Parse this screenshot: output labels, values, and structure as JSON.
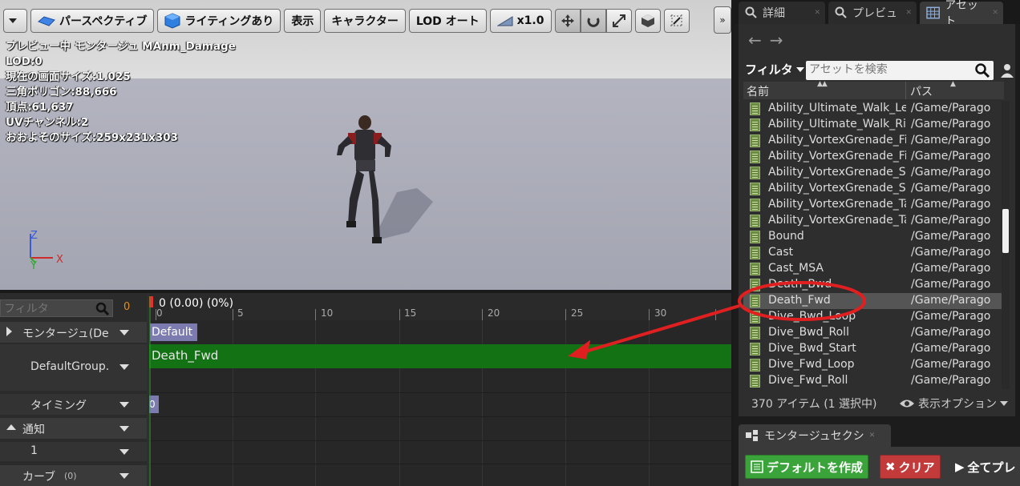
{
  "viewport": {
    "toolbar": {
      "perspective_label": "パースペクティブ",
      "lighting_label": "ライティングあり",
      "show_label": "表示",
      "character_label": "キャラクター",
      "lod_label": "LOD オート",
      "speed_label": "x1.0",
      "more_label": "»"
    },
    "stats": [
      "プレビュー中 モンタージュ MAnm_Damage",
      "LOD:0",
      "現在の画面サイズ:1.025",
      "三角ポリゴン:88,666",
      "頂点:61,637",
      "UVチャンネル:2",
      "おおよそのサイズ:259x231x303"
    ],
    "axis": {
      "z": "Z",
      "x": "X",
      "y": "Y"
    }
  },
  "timeline": {
    "filter_placeholder": "フィルタ",
    "count": "0",
    "position_readout": "0 (0.00) (0%)",
    "ruler_labels": [
      "0",
      "5",
      "10",
      "15",
      "20",
      "25",
      "30"
    ],
    "rows": {
      "montage": "モンタージュ(De",
      "default_group": "DefaultGroup.",
      "timing": "タイミング",
      "notify": "通知",
      "notify_track": "1",
      "curve": "カーブ",
      "curve_count": "(0)"
    },
    "segments": {
      "default_section": "Default",
      "slot_anim": "Death_Fwd",
      "timing_marker": "0"
    }
  },
  "right_panel": {
    "tabs": [
      {
        "label": "詳細",
        "icon": "details-icon"
      },
      {
        "label": "プレビュ",
        "icon": "preview-icon"
      },
      {
        "label": "アセット",
        "icon": "grid-icon"
      }
    ],
    "filter_label": "フィルタ",
    "search_placeholder": "アセットを検索",
    "columns": {
      "name": "名前",
      "path": "パス"
    },
    "assets": [
      {
        "name": "Ability_Ultimate_Walk_Left",
        "path": "/Game/Paragon"
      },
      {
        "name": "Ability_Ultimate_Walk_Right",
        "path": "/Game/Paragon"
      },
      {
        "name": "Ability_VortexGrenade_Fire",
        "path": "/Game/Paragon"
      },
      {
        "name": "Ability_VortexGrenade_Fire",
        "path": "/Game/Paragon"
      },
      {
        "name": "Ability_VortexGrenade_Start",
        "path": "/Game/Paragon"
      },
      {
        "name": "Ability_VortexGrenade_Start",
        "path": "/Game/Paragon"
      },
      {
        "name": "Ability_VortexGrenade_Target",
        "path": "/Game/Paragon"
      },
      {
        "name": "Ability_VortexGrenade_Target",
        "path": "/Game/Paragon"
      },
      {
        "name": "Bound",
        "path": "/Game/Paragon"
      },
      {
        "name": "Cast",
        "path": "/Game/Paragon"
      },
      {
        "name": "Cast_MSA",
        "path": "/Game/Paragon"
      },
      {
        "name": "Death_Bwd",
        "path": "/Game/Paragon"
      },
      {
        "name": "Death_Fwd",
        "path": "/Game/Paragon",
        "selected": true
      },
      {
        "name": "Dive_Bwd_Loop",
        "path": "/Game/Paragon"
      },
      {
        "name": "Dive_Bwd_Roll",
        "path": "/Game/Paragon"
      },
      {
        "name": "Dive_Bwd_Start",
        "path": "/Game/Paragon"
      },
      {
        "name": "Dive_Fwd_Loop",
        "path": "/Game/Paragon"
      },
      {
        "name": "Dive_Fwd_Roll",
        "path": "/Game/Paragon"
      }
    ],
    "item_count": "370 アイテム (1 選択中)",
    "view_options": "表示オプション",
    "montage_tab": "モンタージュセクシ",
    "buttons": {
      "default": "デフォルトを作成",
      "clear": "クリア",
      "play_all": "全てプレ"
    }
  },
  "colors": {
    "slot_green": "#137213",
    "section_purple": "#7c7bb0",
    "annotation_red": "#e02020",
    "accent_orange": "#e08b2a"
  }
}
